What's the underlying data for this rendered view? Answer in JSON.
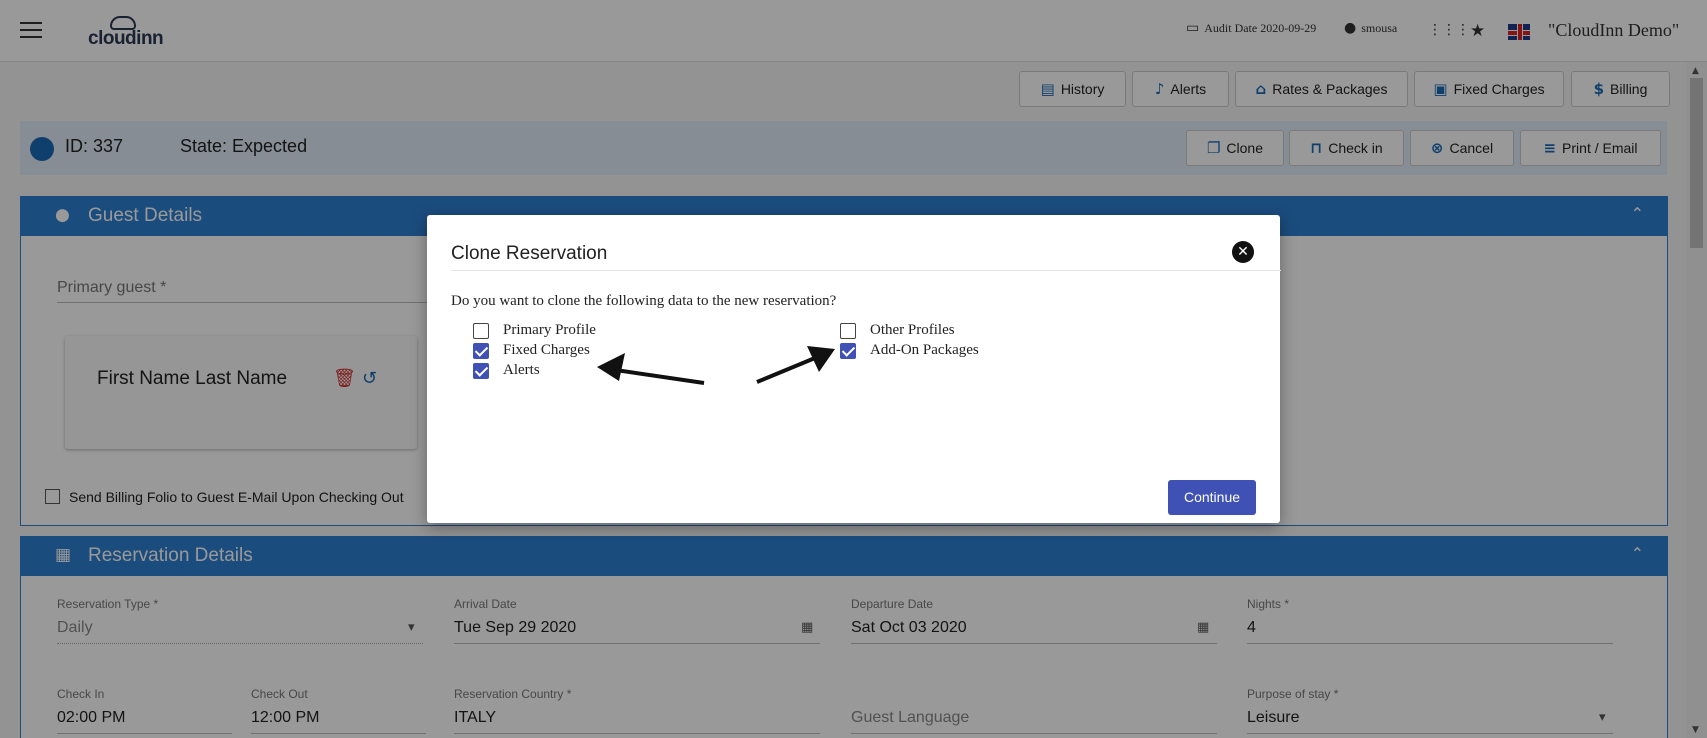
{
  "topbar": {
    "audit_date": "Audit Date 2020-09-29",
    "user": "smousa",
    "property": "\"CloudInn Demo\"",
    "logo_text": "cloudinn"
  },
  "actions": {
    "history": "History",
    "alerts": "Alerts",
    "rates": "Rates & Packages",
    "fixed_charges": "Fixed Charges",
    "billing": "Billing"
  },
  "reservation": {
    "id": "ID: 337",
    "state": "State: Expected",
    "clone": "Clone",
    "check_in": "Check in",
    "cancel": "Cancel",
    "print": "Print / Email"
  },
  "guest_details": {
    "title": "Guest Details",
    "primary_guest_label": "Primary guest *",
    "guest_name": "First Name Last Name",
    "send_billing_label": "Send Billing Folio to Guest E-Mail Upon Checking Out"
  },
  "reservation_details": {
    "title": "Reservation Details",
    "type_label": "Reservation Type *",
    "type_value": "Daily",
    "arrival_label": "Arrival Date",
    "arrival_value": "Tue Sep 29 2020",
    "departure_label": "Departure Date",
    "departure_value": "Sat Oct 03 2020",
    "nights_label": "Nights *",
    "nights_value": "4",
    "check_in_label": "Check In",
    "check_in_value": "02:00 PM",
    "check_out_label": "Check Out",
    "check_out_value": "12:00 PM",
    "country_label": "Reservation Country *",
    "country_value": "ITALY",
    "language_label": "Guest Language",
    "purpose_label": "Purpose of stay *",
    "purpose_value": "Leisure"
  },
  "modal": {
    "title": "Clone Reservation",
    "question": "Do you want to clone the following data to the new reservation?",
    "options_left": [
      {
        "label": "Primary Profile",
        "checked": false
      },
      {
        "label": "Fixed Charges",
        "checked": true
      },
      {
        "label": "Alerts",
        "checked": true
      }
    ],
    "options_right": [
      {
        "label": "Other Profiles",
        "checked": false
      },
      {
        "label": "Add-On Packages",
        "checked": true
      }
    ],
    "continue": "Continue"
  },
  "colors": {
    "primary_blue": "#2d7fd2",
    "modal_button": "#3f51b5",
    "checkbox_checked": "#3f51b5"
  }
}
